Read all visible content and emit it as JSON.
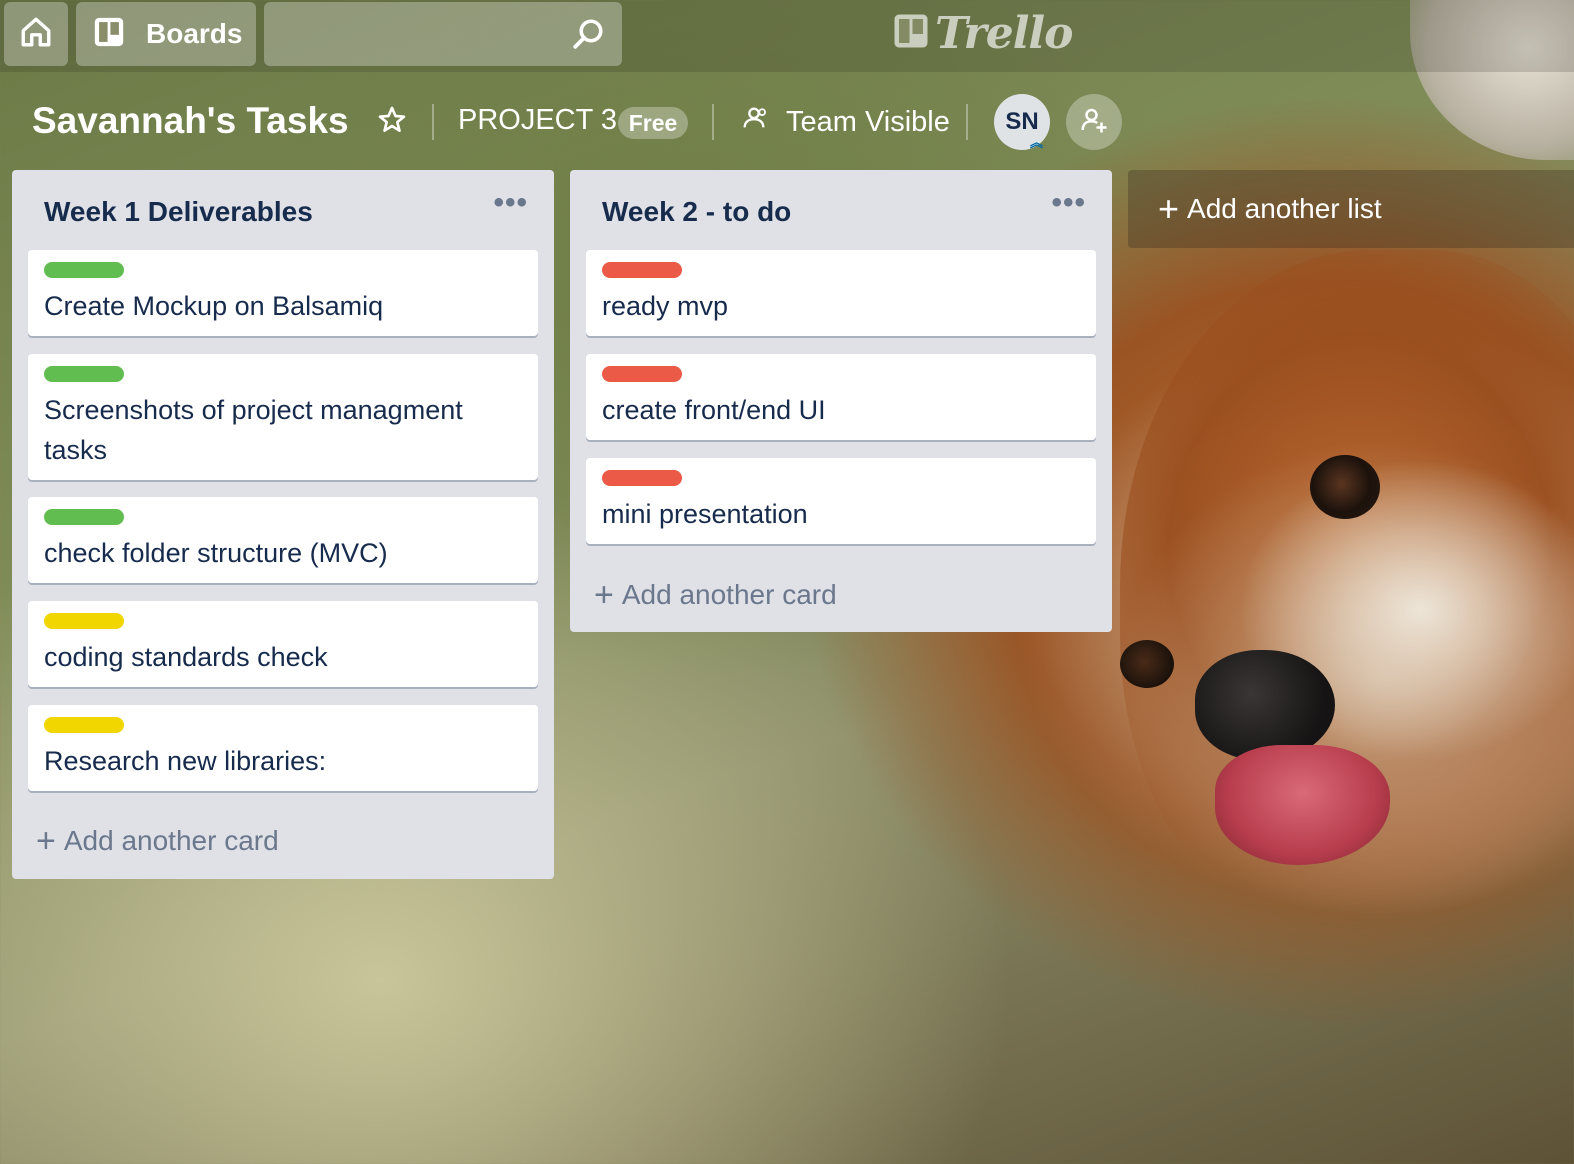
{
  "nav": {
    "boards_label": "Boards",
    "search_placeholder": "",
    "logo_text": "Trello"
  },
  "board": {
    "title": "Savannah's Tasks",
    "team_name": "PROJECT 3",
    "plan_badge": "Free",
    "visibility": "Team Visible",
    "member_initials": "SN"
  },
  "colors": {
    "label_green": "#61bd4f",
    "label_yellow": "#f2d600",
    "label_red": "#eb5a46",
    "list_bg": "#dfe1e6"
  },
  "lists": [
    {
      "title": "Week 1 Deliverables",
      "menu": "•••",
      "add_card": "Add another card",
      "cards": [
        {
          "label_color": "green",
          "text": "Create Mockup on Balsamiq"
        },
        {
          "label_color": "green",
          "text": "Screenshots of project managment tasks"
        },
        {
          "label_color": "green",
          "text": "check folder structure (MVC)"
        },
        {
          "label_color": "yellow",
          "text": "coding standards check"
        },
        {
          "label_color": "yellow",
          "text": "Research new libraries:"
        }
      ]
    },
    {
      "title": "Week 2 - to do",
      "menu": "•••",
      "add_card": "Add another card",
      "cards": [
        {
          "label_color": "red",
          "text": "ready mvp"
        },
        {
          "label_color": "red",
          "text": "create front/end UI"
        },
        {
          "label_color": "red",
          "text": "mini presentation"
        }
      ]
    }
  ],
  "add_list": "Add another list",
  "icons": {
    "home": "home-icon",
    "boards": "boards-icon",
    "search": "search-icon",
    "star": "star-icon",
    "team": "team-icon",
    "invite": "add-member-icon"
  }
}
